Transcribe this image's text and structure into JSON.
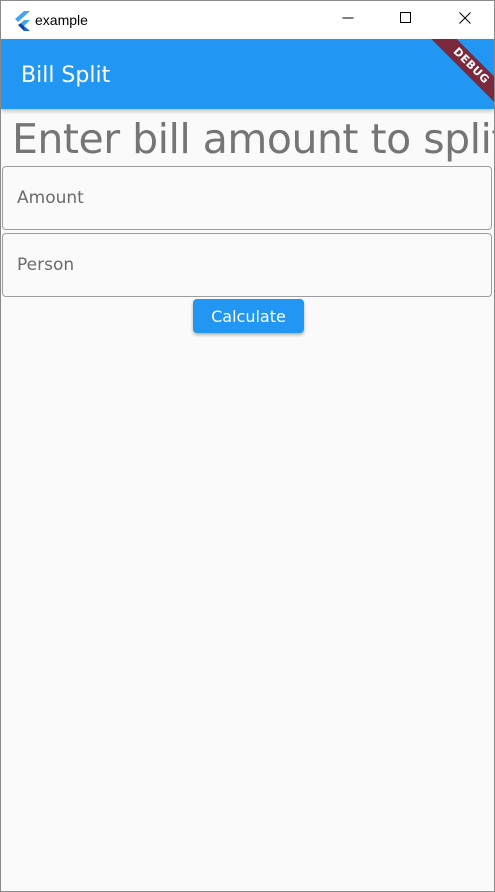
{
  "window": {
    "title": "example",
    "logo_icon": "flutter-logo-icon",
    "controls": {
      "minimize_icon": "minimize-icon",
      "maximize_icon": "maximize-icon",
      "close_icon": "close-icon"
    }
  },
  "appbar": {
    "title": "Bill Split",
    "debug_banner": "DEBUG",
    "color": "#2196f3"
  },
  "main": {
    "heading": "Enter bill amount to split.",
    "amount_field": {
      "placeholder": "Amount",
      "value": ""
    },
    "person_field": {
      "placeholder": "Person",
      "value": ""
    },
    "calculate_label": "Calculate"
  },
  "colors": {
    "accent": "#2196f3",
    "background": "#fafafa",
    "debug_ribbon": "#7a2a3c",
    "heading_text": "#757575"
  }
}
